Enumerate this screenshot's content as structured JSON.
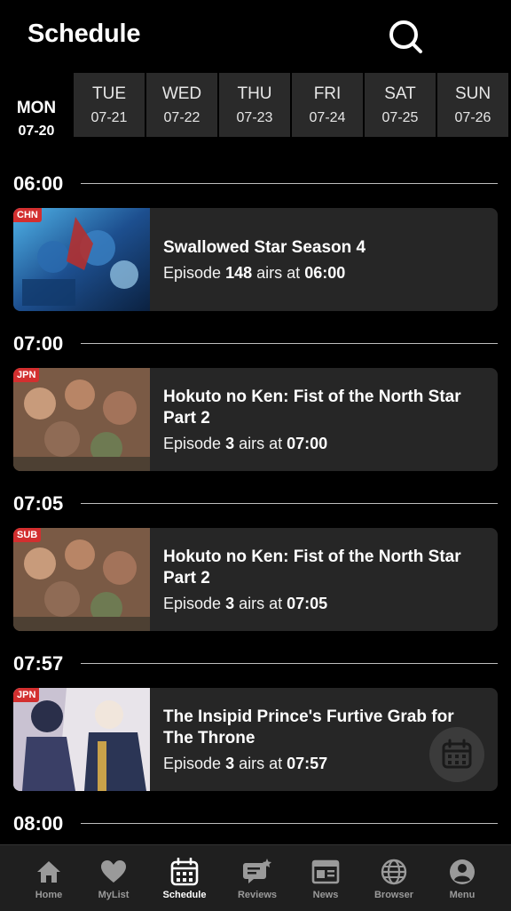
{
  "header": {
    "title": "Schedule",
    "search_icon": "search-icon"
  },
  "days": [
    {
      "name": "MON",
      "date": "07-20",
      "active": true
    },
    {
      "name": "TUE",
      "date": "07-21"
    },
    {
      "name": "WED",
      "date": "07-22"
    },
    {
      "name": "THU",
      "date": "07-23"
    },
    {
      "name": "FRI",
      "date": "07-24"
    },
    {
      "name": "SAT",
      "date": "07-25"
    },
    {
      "name": "SUN",
      "date": "07-26"
    }
  ],
  "sections": [
    {
      "time": "06:00",
      "card": {
        "badge": "CHN",
        "title": "Swallowed Star Season 4",
        "ep_prefix": "Episode",
        "ep_num": "148",
        "ep_mid": "airs at",
        "air_time": "06:00"
      }
    },
    {
      "time": "07:00",
      "card": {
        "badge": "JPN",
        "title_line1": "Hokuto no Ken: Fist of the North Star",
        "title_line2": "Part 2",
        "ep_prefix": "Episode",
        "ep_num": "3",
        "ep_mid": "airs at",
        "air_time": "07:00"
      }
    },
    {
      "time": "07:05",
      "card": {
        "badge": "SUB",
        "title_line1": "Hokuto no Ken: Fist of the North Star",
        "title_line2": "Part 2",
        "ep_prefix": "Episode",
        "ep_num": "3",
        "ep_mid": "airs at",
        "air_time": "07:05"
      }
    },
    {
      "time": "07:57",
      "card": {
        "badge": "JPN",
        "title_line1": "The Insipid Prince's Furtive Grab for",
        "title_line2": "The Throne",
        "ep_prefix": "Episode",
        "ep_num": "3",
        "ep_mid": "airs at",
        "air_time": "07:57"
      }
    },
    {
      "time": "08:00"
    }
  ],
  "fab": {
    "icon": "calendar-icon"
  },
  "bottom_nav": [
    {
      "label": "Home",
      "icon": "home-icon"
    },
    {
      "label": "MyList",
      "icon": "heart-icon"
    },
    {
      "label": "Schedule",
      "icon": "calendar-icon",
      "active": true
    },
    {
      "label": "Reviews",
      "icon": "reviews-icon"
    },
    {
      "label": "News",
      "icon": "news-icon"
    },
    {
      "label": "Browser",
      "icon": "globe-icon"
    },
    {
      "label": "Menu",
      "icon": "user-icon"
    }
  ],
  "colors": {
    "background": "#000000",
    "card": "#262626",
    "badge": "#d32f2f",
    "tab_box": "#2a2a2a",
    "nav_bg": "#1f1f1f"
  }
}
